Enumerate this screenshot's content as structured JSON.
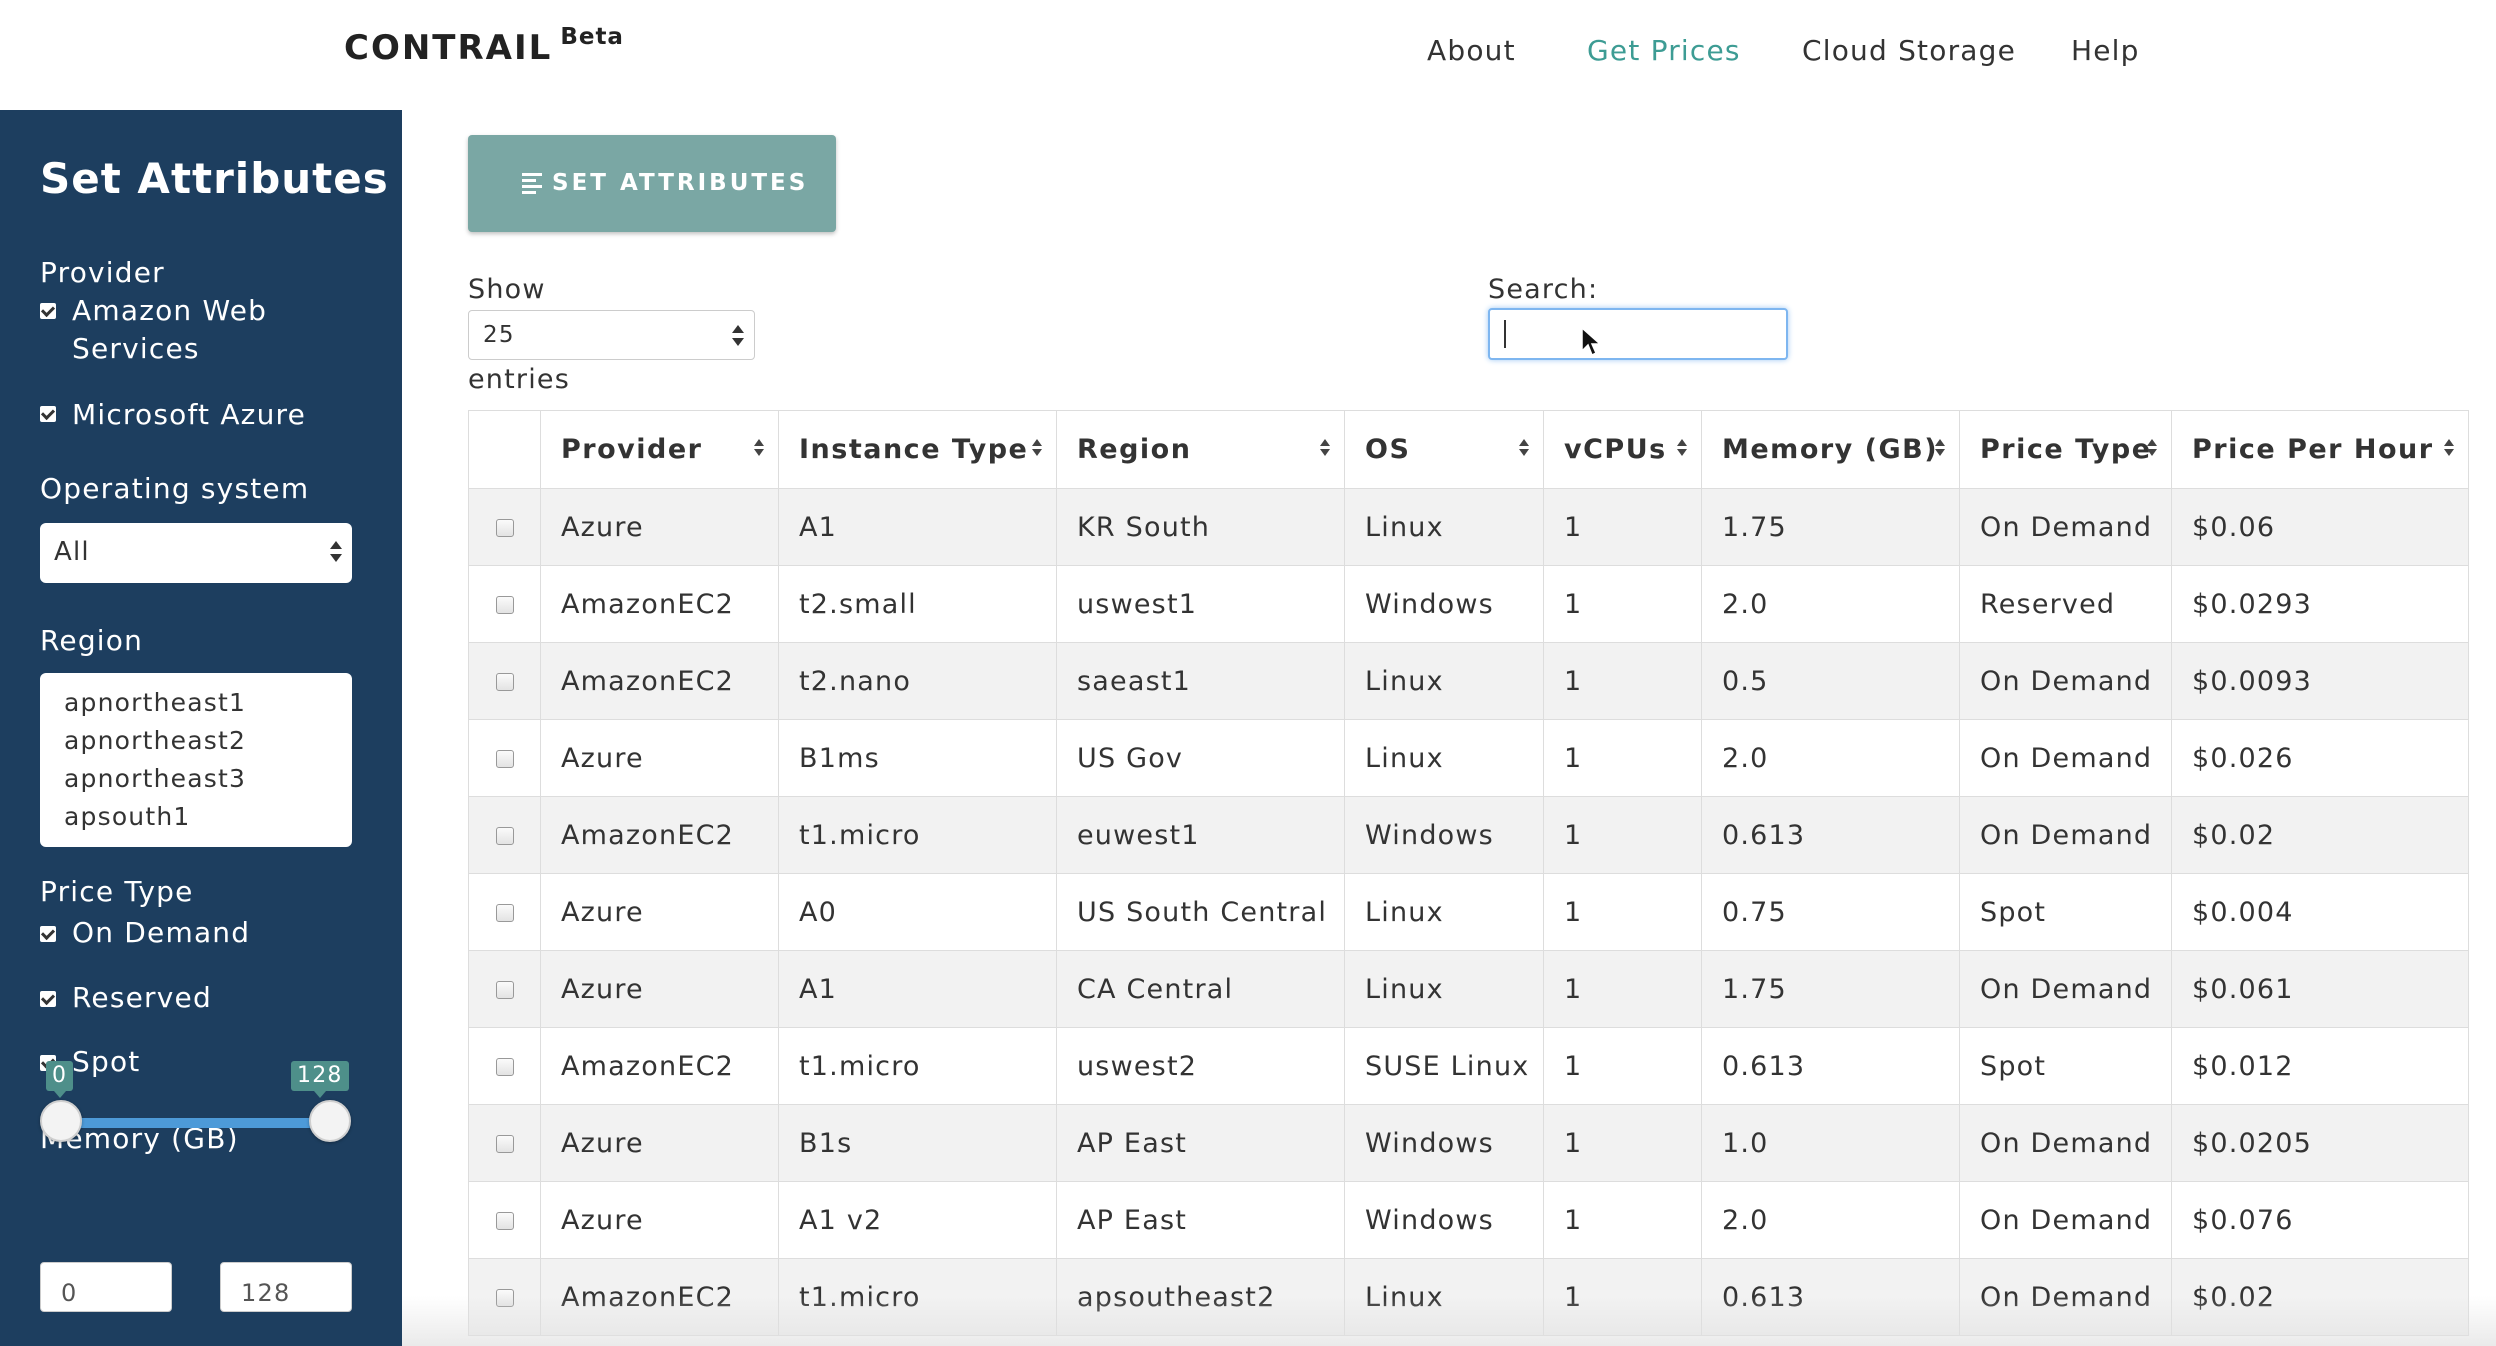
{
  "app": {
    "brand": "CONTRAIL",
    "brand_badge": "Beta"
  },
  "nav": {
    "about": "About",
    "get_prices": "Get Prices",
    "cloud_storage": "Cloud Storage",
    "help": "Help",
    "active_color": "#3d9c94"
  },
  "sidebar": {
    "title": "Set Attributes",
    "bg_color": "#1d3e5f",
    "provider": {
      "label": "Provider",
      "options": [
        {
          "label": "Amazon Web Services",
          "checked": true
        },
        {
          "label": "Microsoft Azure",
          "checked": true
        }
      ]
    },
    "os": {
      "label": "Operating system",
      "selected": "All"
    },
    "region": {
      "label": "Region",
      "options": [
        "apnortheast1",
        "apnortheast2",
        "apnortheast3",
        "apsouth1"
      ]
    },
    "price_type": {
      "label": "Price Type",
      "options": [
        {
          "label": "On Demand",
          "checked": true
        },
        {
          "label": "Reserved",
          "checked": true
        },
        {
          "label": "Spot",
          "checked": true
        }
      ]
    },
    "memory": {
      "label": "Memory (GB)",
      "min_badge": "0",
      "max_badge": "128",
      "min_value": "0",
      "max_value": "128"
    }
  },
  "main": {
    "set_attributes_button": "SET ATTRIBUTES",
    "show_label": "Show",
    "show_value": "25",
    "entries_label": "entries",
    "search_label": "Search:",
    "search_value": "",
    "table": {
      "columns": [
        "Provider",
        "Instance Type",
        "Region",
        "OS",
        "vCPUs",
        "Memory (GB)",
        "Price Type",
        "Price Per Hour"
      ],
      "rows": [
        [
          "Azure",
          "A1",
          "KR South",
          "Linux",
          "1",
          "1.75",
          "On Demand",
          "$0.06"
        ],
        [
          "AmazonEC2",
          "t2.small",
          "uswest1",
          "Windows",
          "1",
          "2.0",
          "Reserved",
          "$0.0293"
        ],
        [
          "AmazonEC2",
          "t2.nano",
          "saeast1",
          "Linux",
          "1",
          "0.5",
          "On Demand",
          "$0.0093"
        ],
        [
          "Azure",
          "B1ms",
          "US Gov",
          "Linux",
          "1",
          "2.0",
          "On Demand",
          "$0.026"
        ],
        [
          "AmazonEC2",
          "t1.micro",
          "euwest1",
          "Windows",
          "1",
          "0.613",
          "On Demand",
          "$0.02"
        ],
        [
          "Azure",
          "A0",
          "US South Central",
          "Linux",
          "1",
          "0.75",
          "Spot",
          "$0.004"
        ],
        [
          "Azure",
          "A1",
          "CA Central",
          "Linux",
          "1",
          "1.75",
          "On Demand",
          "$0.061"
        ],
        [
          "AmazonEC2",
          "t1.micro",
          "uswest2",
          "SUSE Linux",
          "1",
          "0.613",
          "Spot",
          "$0.012"
        ],
        [
          "Azure",
          "B1s",
          "AP East",
          "Windows",
          "1",
          "1.0",
          "On Demand",
          "$0.0205"
        ],
        [
          "Azure",
          "A1 v2",
          "AP East",
          "Windows",
          "1",
          "2.0",
          "On Demand",
          "$0.076"
        ],
        [
          "AmazonEC2",
          "t1.micro",
          "apsoutheast2",
          "Linux",
          "1",
          "0.613",
          "On Demand",
          "$0.02"
        ]
      ]
    }
  }
}
